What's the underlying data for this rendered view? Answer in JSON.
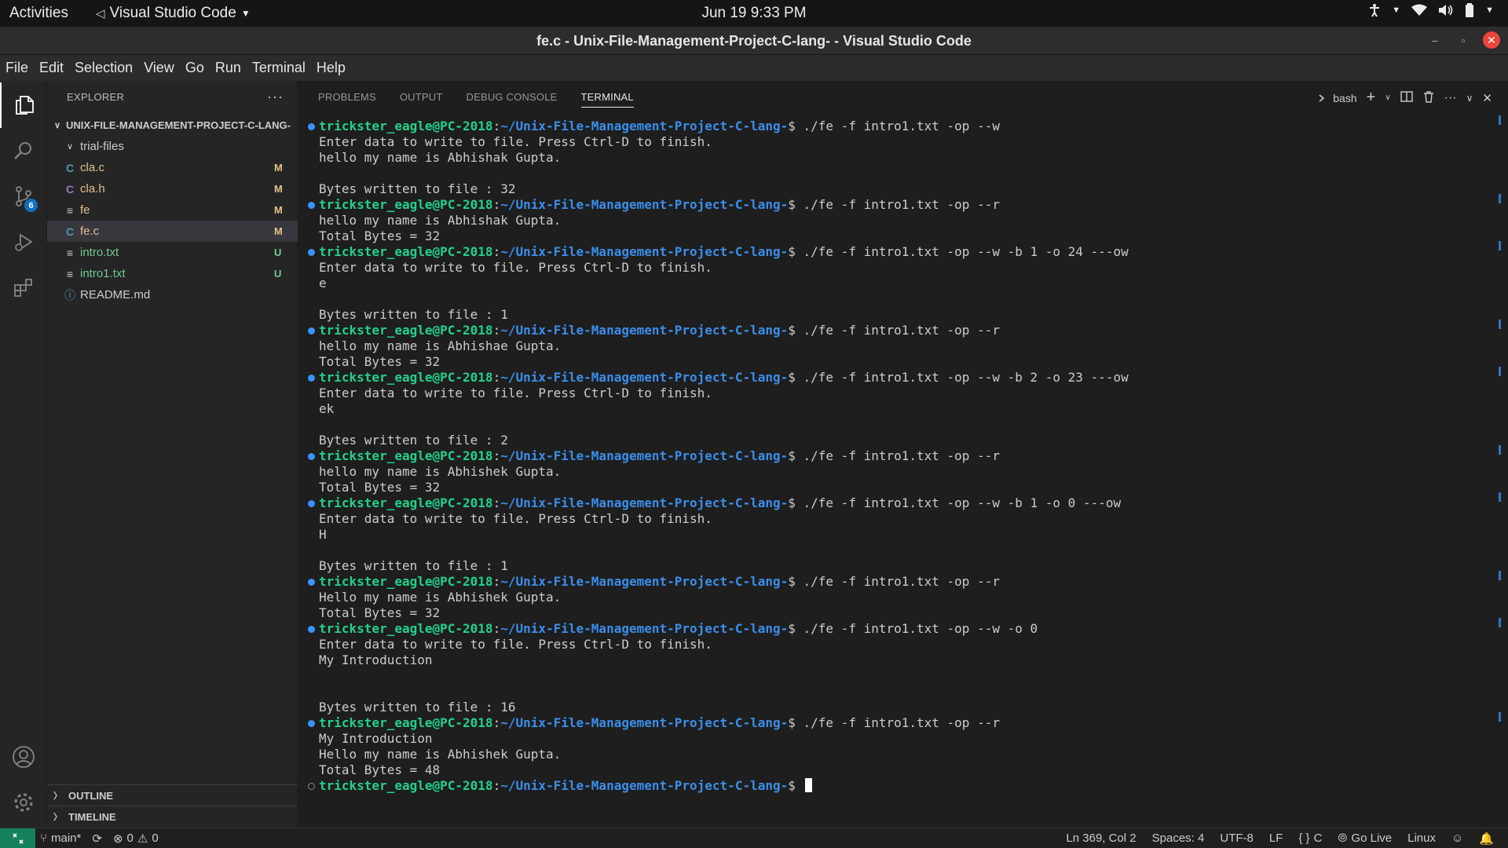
{
  "topbar": {
    "activities": "Activities",
    "app_name": "Visual Studio Code",
    "clock": "Jun 19  9:33 PM"
  },
  "window": {
    "title": "fe.c - Unix-File-Management-Project-C-lang- - Visual Studio Code"
  },
  "menu": [
    "File",
    "Edit",
    "Selection",
    "View",
    "Go",
    "Run",
    "Terminal",
    "Help"
  ],
  "activitybar": {
    "source_control_badge": "6"
  },
  "explorer": {
    "header": "EXPLORER",
    "project": "UNIX-FILE-MANAGEMENT-PROJECT-C-LANG-",
    "items": [
      {
        "name": "trial-files",
        "icon": "chevron",
        "status": "",
        "kind": "folder"
      },
      {
        "name": "cla.c",
        "icon": "C",
        "status": "M",
        "kind": "modified"
      },
      {
        "name": "cla.h",
        "icon": "C",
        "status": "M",
        "kind": "modified"
      },
      {
        "name": "fe",
        "icon": "≡",
        "status": "M",
        "kind": "modified"
      },
      {
        "name": "fe.c",
        "icon": "C",
        "status": "M",
        "kind": "modified"
      },
      {
        "name": "intro.txt",
        "icon": "≡",
        "status": "U",
        "kind": "untracked"
      },
      {
        "name": "intro1.txt",
        "icon": "≡",
        "status": "U",
        "kind": "untracked"
      },
      {
        "name": "README.md",
        "icon": "ⓘ",
        "status": "",
        "kind": "plain"
      }
    ],
    "outline": "OUTLINE",
    "timeline": "TIMELINE"
  },
  "panel": {
    "tabs": [
      "PROBLEMS",
      "OUTPUT",
      "DEBUG CONSOLE",
      "TERMINAL"
    ],
    "active_tab": "TERMINAL",
    "shell": "bash"
  },
  "terminal": {
    "user": "trickster_eagle@PC-2018",
    "path": "~/Unix-File-Management-Project-C-lang-",
    "lines": [
      {
        "type": "cmd",
        "cmd": "./fe -f intro1.txt -op --w"
      },
      {
        "type": "out",
        "text": "Enter data to write to file. Press Ctrl-D to finish."
      },
      {
        "type": "out",
        "text": "hello my name is Abhishak Gupta."
      },
      {
        "type": "out",
        "text": ""
      },
      {
        "type": "out",
        "text": "Bytes written to file : 32"
      },
      {
        "type": "cmd",
        "cmd": "./fe -f intro1.txt -op --r"
      },
      {
        "type": "out",
        "text": "hello my name is Abhishak Gupta."
      },
      {
        "type": "out",
        "text": "Total Bytes = 32"
      },
      {
        "type": "cmd",
        "cmd": "./fe -f intro1.txt -op --w -b 1 -o 24 ---ow"
      },
      {
        "type": "out",
        "text": "Enter data to write to file. Press Ctrl-D to finish."
      },
      {
        "type": "out",
        "text": "e"
      },
      {
        "type": "out",
        "text": ""
      },
      {
        "type": "out",
        "text": "Bytes written to file : 1"
      },
      {
        "type": "cmd",
        "cmd": "./fe -f intro1.txt -op --r"
      },
      {
        "type": "out",
        "text": "hello my name is Abhishae Gupta."
      },
      {
        "type": "out",
        "text": "Total Bytes = 32"
      },
      {
        "type": "cmd",
        "cmd": "./fe -f intro1.txt -op --w -b 2 -o 23 ---ow"
      },
      {
        "type": "out",
        "text": "Enter data to write to file. Press Ctrl-D to finish."
      },
      {
        "type": "out",
        "text": "ek"
      },
      {
        "type": "out",
        "text": ""
      },
      {
        "type": "out",
        "text": "Bytes written to file : 2"
      },
      {
        "type": "cmd",
        "cmd": "./fe -f intro1.txt -op --r"
      },
      {
        "type": "out",
        "text": "hello my name is Abhishek Gupta."
      },
      {
        "type": "out",
        "text": "Total Bytes = 32"
      },
      {
        "type": "cmd",
        "cmd": "./fe -f intro1.txt -op --w -b 1 -o 0 ---ow"
      },
      {
        "type": "out",
        "text": "Enter data to write to file. Press Ctrl-D to finish."
      },
      {
        "type": "out",
        "text": "H"
      },
      {
        "type": "out",
        "text": ""
      },
      {
        "type": "out",
        "text": "Bytes written to file : 1"
      },
      {
        "type": "cmd",
        "cmd": "./fe -f intro1.txt -op --r"
      },
      {
        "type": "out",
        "text": "Hello my name is Abhishek Gupta."
      },
      {
        "type": "out",
        "text": "Total Bytes = 32"
      },
      {
        "type": "cmd",
        "cmd": "./fe -f intro1.txt -op --w -o 0"
      },
      {
        "type": "out",
        "text": "Enter data to write to file. Press Ctrl-D to finish."
      },
      {
        "type": "out",
        "text": "My Introduction"
      },
      {
        "type": "out",
        "text": ""
      },
      {
        "type": "out",
        "text": ""
      },
      {
        "type": "out",
        "text": "Bytes written to file : 16"
      },
      {
        "type": "cmd",
        "cmd": "./fe -f intro1.txt -op --r"
      },
      {
        "type": "out",
        "text": "My Introduction"
      },
      {
        "type": "out",
        "text": "Hello my name is Abhishek Gupta."
      },
      {
        "type": "out",
        "text": "Total Bytes = 48"
      },
      {
        "type": "prompt",
        "cmd": ""
      }
    ]
  },
  "statusbar": {
    "branch": "main*",
    "errors": "0",
    "warnings": "0",
    "position": "Ln 369, Col 2",
    "spaces": "Spaces: 4",
    "encoding": "UTF-8",
    "eol": "LF",
    "language": "C",
    "golive": "Go Live",
    "platform": "Linux"
  },
  "colors": {
    "prompt_user": "#23d18b",
    "prompt_path": "#3b8eea",
    "modified": "#e2c08d",
    "untracked": "#73c991",
    "badge": "#0e70c0"
  }
}
